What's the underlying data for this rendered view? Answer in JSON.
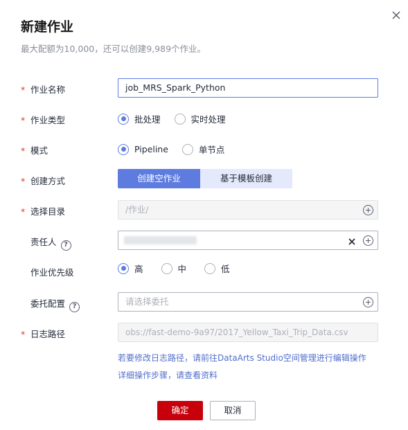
{
  "dialog": {
    "title": "新建作业",
    "subtitle": "最大配额为10,000，还可以创建9,989个作业。"
  },
  "form": {
    "job_name": {
      "label": "作业名称",
      "value": "job_MRS_Spark_Python",
      "required": true
    },
    "job_type": {
      "label": "作业类型",
      "required": true,
      "options": [
        "批处理",
        "实时处理"
      ],
      "selected": "批处理"
    },
    "mode": {
      "label": "模式",
      "required": true,
      "options": [
        "Pipeline",
        "单节点"
      ],
      "selected": "Pipeline"
    },
    "create_method": {
      "label": "创建方式",
      "required": true,
      "options": [
        "创建空作业",
        "基于模板创建"
      ],
      "selected": "创建空作业"
    },
    "directory": {
      "label": "选择目录",
      "required": true,
      "value": "/作业/"
    },
    "owner": {
      "label": "责任人",
      "required": false
    },
    "priority": {
      "label": "作业优先级",
      "required": false,
      "options": [
        "高",
        "中",
        "低"
      ],
      "selected": "高"
    },
    "delegation": {
      "label": "委托配置",
      "required": false,
      "placeholder": "请选择委托"
    },
    "log_path": {
      "label": "日志路径",
      "required": true,
      "value": "obs://fast-demo-9a97/2017_Yellow_Taxi_Trip_Data.csv"
    }
  },
  "hints": {
    "line1": "若要修改日志路径，请前往DataArts Studio空间管理进行编辑操作",
    "line2": "详细操作步骤，请查看资料"
  },
  "buttons": {
    "ok": "确定",
    "cancel": "取消"
  },
  "glyphs": {
    "required_mark": "*",
    "help_mark": "?"
  },
  "colors": {
    "primary": "#5e7ce0",
    "danger_button": "#c7000b",
    "required_mark": "#e4322b",
    "link": "#526ecc"
  }
}
